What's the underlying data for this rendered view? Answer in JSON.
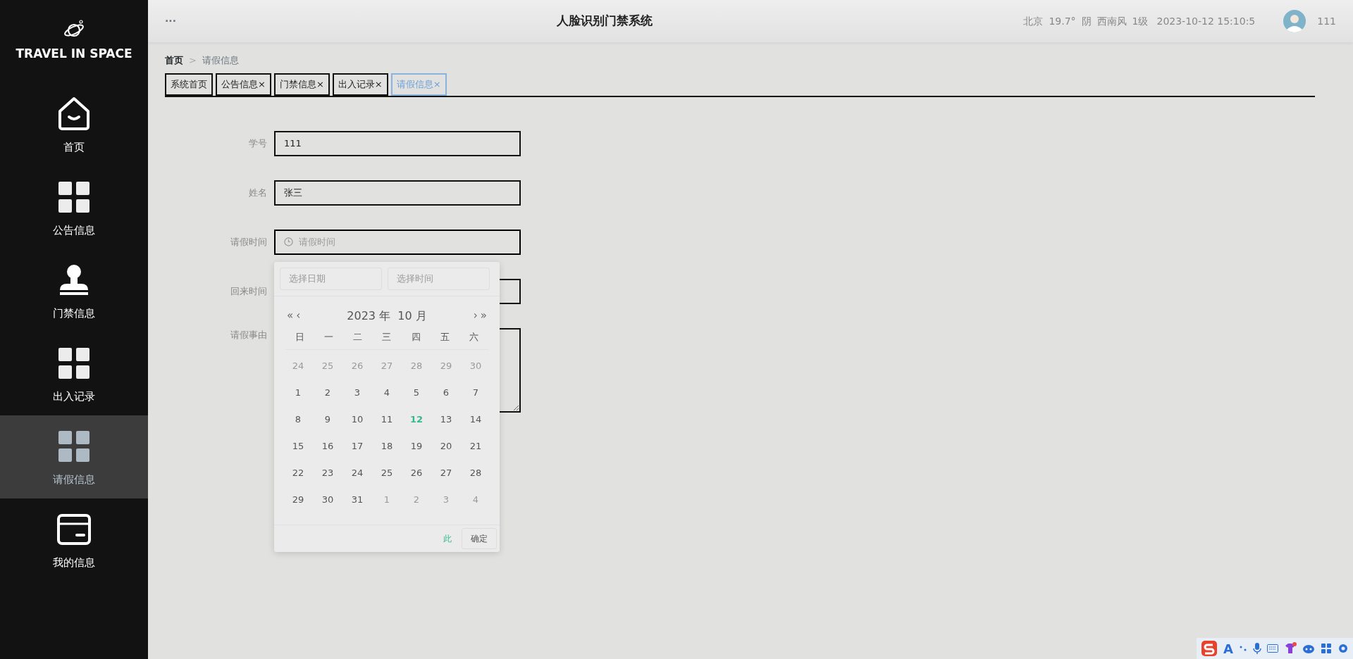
{
  "sidebar": {
    "logo_text": "TRAVEL IN SPACE",
    "items": [
      {
        "label": "首页",
        "kind": "home",
        "selected": false
      },
      {
        "label": "公告信息",
        "kind": "grid",
        "selected": false
      },
      {
        "label": "门禁信息",
        "kind": "stamp",
        "selected": false
      },
      {
        "label": "出入记录",
        "kind": "grid",
        "selected": false
      },
      {
        "label": "请假信息",
        "kind": "grid",
        "selected": true
      },
      {
        "label": "我的信息",
        "kind": "card",
        "selected": false
      }
    ]
  },
  "header": {
    "menu": "···",
    "title": "人脸识别门禁系统",
    "weather": [
      "北京",
      "19.7°",
      "阴",
      "西南风",
      "1级"
    ],
    "datetime": "2023-10-12 15:10:5",
    "user": "111"
  },
  "breadcrumb": {
    "items": [
      {
        "label": "首页",
        "current": false
      },
      {
        "label": "请假信息",
        "current": true
      }
    ],
    "separator": ">"
  },
  "tabs": [
    {
      "label": "系统首页",
      "selected": false
    },
    {
      "label": "公告信息",
      "close": "×",
      "selected": false
    },
    {
      "label": "门禁信息",
      "close": "×",
      "selected": false
    },
    {
      "label": "出入记录",
      "close": "×",
      "selected": false
    },
    {
      "label": "请假信息",
      "close": "×",
      "selected": true
    }
  ],
  "form": [
    {
      "label": "学号",
      "kind": "input",
      "value": "111"
    },
    {
      "label": "姓名",
      "kind": "input",
      "value": "张三"
    },
    {
      "label": "请假时间",
      "kind": "datetime",
      "placeholder": "请假时间",
      "open": true
    },
    {
      "label": "回来时间",
      "kind": "datetime",
      "open": false
    },
    {
      "label": "请假事由",
      "kind": "textarea"
    }
  ],
  "date_picker": {
    "date_placeholder": "选择日期",
    "time_placeholder": "选择时间",
    "prev_year": "«",
    "prev_month": "‹",
    "title": "2023 年  10 月",
    "next_month": "›",
    "next_year": "»",
    "weekdays": [
      "日",
      "一",
      "二",
      "三",
      "四",
      "五",
      "六"
    ],
    "weeks": [
      [
        {
          "day": "24",
          "other_month": true,
          "today": false
        },
        {
          "day": "25",
          "other_month": true,
          "today": false
        },
        {
          "day": "26",
          "other_month": true,
          "today": false
        },
        {
          "day": "27",
          "other_month": true,
          "today": false
        },
        {
          "day": "28",
          "other_month": true,
          "today": false
        },
        {
          "day": "29",
          "other_month": true,
          "today": false
        },
        {
          "day": "30",
          "other_month": true,
          "today": false
        }
      ],
      [
        {
          "day": "1",
          "other_month": false,
          "today": false
        },
        {
          "day": "2",
          "other_month": false,
          "today": false
        },
        {
          "day": "3",
          "other_month": false,
          "today": false
        },
        {
          "day": "4",
          "other_month": false,
          "today": false
        },
        {
          "day": "5",
          "other_month": false,
          "today": false
        },
        {
          "day": "6",
          "other_month": false,
          "today": false
        },
        {
          "day": "7",
          "other_month": false,
          "today": false
        }
      ],
      [
        {
          "day": "8",
          "other_month": false,
          "today": false
        },
        {
          "day": "9",
          "other_month": false,
          "today": false
        },
        {
          "day": "10",
          "other_month": false,
          "today": false
        },
        {
          "day": "11",
          "other_month": false,
          "today": false
        },
        {
          "day": "12",
          "other_month": false,
          "today": true
        },
        {
          "day": "13",
          "other_month": false,
          "today": false
        },
        {
          "day": "14",
          "other_month": false,
          "today": false
        }
      ],
      [
        {
          "day": "15",
          "other_month": false,
          "today": false
        },
        {
          "day": "16",
          "other_month": false,
          "today": false
        },
        {
          "day": "17",
          "other_month": false,
          "today": false
        },
        {
          "day": "18",
          "other_month": false,
          "today": false
        },
        {
          "day": "19",
          "other_month": false,
          "today": false
        },
        {
          "day": "20",
          "other_month": false,
          "today": false
        },
        {
          "day": "21",
          "other_month": false,
          "today": false
        }
      ],
      [
        {
          "day": "22",
          "other_month": false,
          "today": false
        },
        {
          "day": "23",
          "other_month": false,
          "today": false
        },
        {
          "day": "24",
          "other_month": false,
          "today": false
        },
        {
          "day": "25",
          "other_month": false,
          "today": false
        },
        {
          "day": "26",
          "other_month": false,
          "today": false
        },
        {
          "day": "27",
          "other_month": false,
          "today": false
        },
        {
          "day": "28",
          "other_month": false,
          "today": false
        }
      ],
      [
        {
          "day": "29",
          "other_month": false,
          "today": false
        },
        {
          "day": "30",
          "other_month": false,
          "today": false
        },
        {
          "day": "31",
          "other_month": false,
          "today": false
        },
        {
          "day": "1",
          "other_month": true,
          "today": false
        },
        {
          "day": "2",
          "other_month": true,
          "today": false
        },
        {
          "day": "3",
          "other_month": true,
          "today": false
        },
        {
          "day": "4",
          "other_month": true,
          "today": false
        }
      ]
    ],
    "now_button": "此",
    "confirm_button": "确定"
  },
  "ime_toolbar": {
    "letter": "A"
  }
}
